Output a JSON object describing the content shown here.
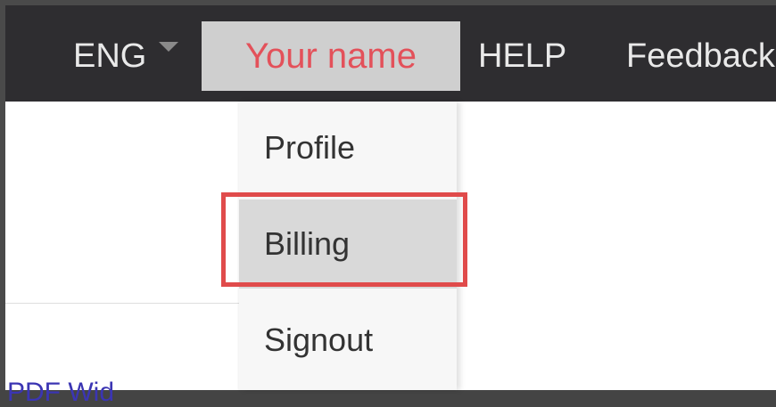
{
  "header": {
    "language": "ENG",
    "user_menu_label": "Your name",
    "help_label": "HELP",
    "feedback_label": "Feedback"
  },
  "user_dropdown": {
    "items": [
      {
        "label": "Profile"
      },
      {
        "label": "Billing"
      },
      {
        "label": "Signout"
      }
    ],
    "highlighted_item": "Billing"
  },
  "page": {
    "link_fragment": "PDF Wid"
  },
  "colors": {
    "topbar": "#2e2d30",
    "user_tab_bg": "#cfcfcf",
    "user_tab_text": "#e3515a",
    "highlight_border": "#e04b4b",
    "link": "#3b35b3"
  }
}
